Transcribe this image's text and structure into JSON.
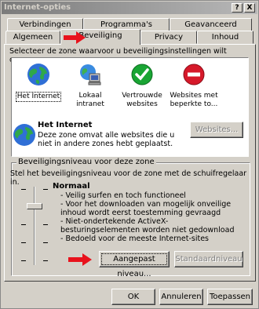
{
  "window": {
    "title": "Internet-opties",
    "help_button": "?",
    "close_button": "X"
  },
  "tabs_row_back": [
    "Verbindingen",
    "Programma's",
    "Geavanceerd"
  ],
  "tabs_row_front": [
    "Algemeen",
    "Beveiliging",
    "Privacy",
    "Inhoud"
  ],
  "active_tab": "Beveiliging",
  "security": {
    "instruction": "Selecteer de zone waarvoor u beveiligingsinstellingen wilt opgeven.",
    "zones": [
      {
        "label": "Het Internet",
        "icon": "globe-icon"
      },
      {
        "label": "Lokaal intranet",
        "icon": "intranet-computer-icon"
      },
      {
        "label": "Vertrouwde websites",
        "icon": "checkmark-icon"
      },
      {
        "label": "Websites met beperkte to...",
        "icon": "restricted-icon"
      }
    ],
    "selected_zone": {
      "title": "Het Internet",
      "description": "Deze zone omvat alle websites die u niet in andere zones hebt geplaatst.",
      "sites_button": "Websites..."
    },
    "level_group": {
      "title": "Beveiligingsniveau voor deze zone",
      "hint": "Stel het beveiligingsniveau voor de zone met de schuifregelaar in.",
      "level_name": "Normaal",
      "bullets": [
        "- Veilig surfen en toch functioneel",
        "- Voor het downloaden van mogelijk onveilige inhoud wordt eerst toestemming gevraagd",
        "- Niet-ondertekende ActiveX-besturingselementen worden niet gedownload",
        "- Bedoeld voor de meeste Internet-sites"
      ],
      "custom_button": "Aangepast niveau...",
      "default_button": "Standaardniveau"
    }
  },
  "footer": {
    "ok": "OK",
    "cancel": "Annuleren",
    "apply": "Toepassen"
  },
  "colors": {
    "face": "#d4d0c8",
    "arrow": "#e8121c",
    "title_gradient_start": "#7b7b7b"
  }
}
